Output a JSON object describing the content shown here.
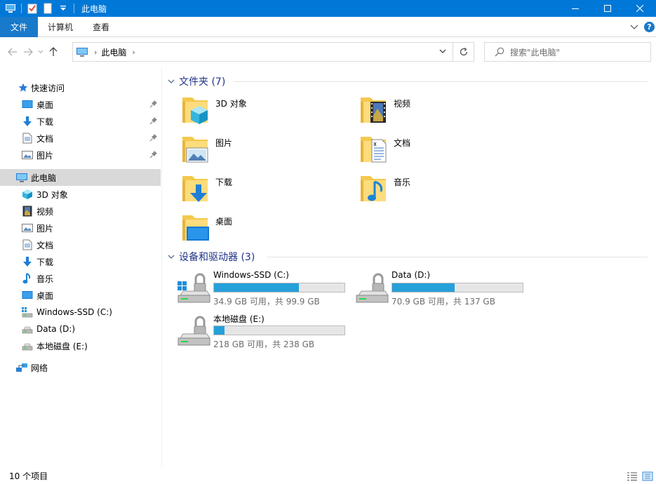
{
  "window": {
    "title": "此电脑",
    "accent": "#0078d7"
  },
  "ribbon": {
    "tabs": [
      {
        "label": "文件"
      },
      {
        "label": "计算机"
      },
      {
        "label": "查看"
      }
    ]
  },
  "address": {
    "crumb": "此电脑"
  },
  "search": {
    "placeholder": "搜索\"此电脑\""
  },
  "sidebar": {
    "quick_access": "快速访问",
    "quick_items": [
      {
        "label": "桌面",
        "icon": "desktop-icon"
      },
      {
        "label": "下载",
        "icon": "download-icon"
      },
      {
        "label": "文档",
        "icon": "document-icon"
      },
      {
        "label": "图片",
        "icon": "picture-icon"
      }
    ],
    "this_pc": "此电脑",
    "pc_items": [
      {
        "label": "3D 对象",
        "icon": "3d-objects-icon"
      },
      {
        "label": "视频",
        "icon": "video-icon"
      },
      {
        "label": "图片",
        "icon": "picture-icon"
      },
      {
        "label": "文档",
        "icon": "document-icon"
      },
      {
        "label": "下载",
        "icon": "download-icon"
      },
      {
        "label": "音乐",
        "icon": "music-icon"
      },
      {
        "label": "桌面",
        "icon": "desktop-icon"
      },
      {
        "label": "Windows-SSD (C:)",
        "icon": "system-drive-icon"
      },
      {
        "label": "Data (D:)",
        "icon": "drive-icon"
      },
      {
        "label": "本地磁盘 (E:)",
        "icon": "drive-icon"
      }
    ],
    "network": "网络"
  },
  "folders": {
    "header": "文件夹 (7)",
    "items": [
      {
        "label": "3D 对象",
        "icon": "3d-objects-folder-icon"
      },
      {
        "label": "视频",
        "icon": "video-folder-icon"
      },
      {
        "label": "图片",
        "icon": "picture-folder-icon"
      },
      {
        "label": "文档",
        "icon": "document-folder-icon"
      },
      {
        "label": "下载",
        "icon": "download-folder-icon"
      },
      {
        "label": "音乐",
        "icon": "music-folder-icon"
      },
      {
        "label": "桌面",
        "icon": "desktop-folder-icon"
      }
    ]
  },
  "drives": {
    "header": "设备和驱动器 (3)",
    "items": [
      {
        "name": "Windows-SSD (C:)",
        "size": "34.9 GB 可用，共 99.9 GB",
        "used_fraction": 0.65,
        "icon": "system-drive-icon"
      },
      {
        "name": "Data (D:)",
        "size": "70.9 GB 可用，共 137 GB",
        "used_fraction": 0.48,
        "icon": "drive-icon"
      },
      {
        "name": "本地磁盘 (E:)",
        "size": "218 GB 可用，共 238 GB",
        "used_fraction": 0.08,
        "icon": "drive-icon"
      }
    ]
  },
  "status": {
    "count": "10 个项目"
  }
}
